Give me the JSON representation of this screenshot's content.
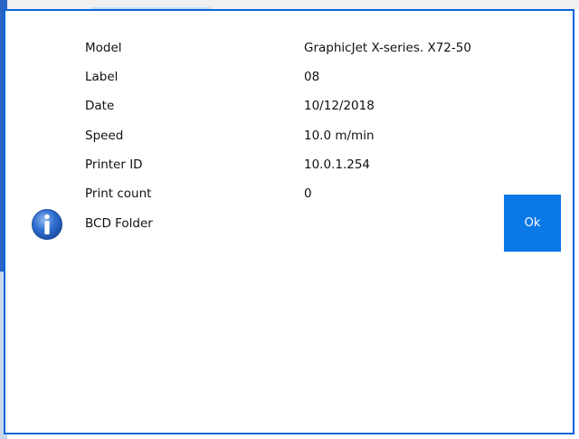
{
  "dialog": {
    "rows": [
      {
        "label": "Model",
        "value": "GraphicJet X-series. X72-50"
      },
      {
        "label": "Label",
        "value": "08"
      },
      {
        "label": "Date",
        "value": "10/12/2018"
      },
      {
        "label": "Speed",
        "value": "10.0 m/min"
      },
      {
        "label": "Printer ID",
        "value": "10.0.1.254"
      },
      {
        "label": "Print count",
        "value": "0"
      },
      {
        "label": "BCD Folder",
        "value": ""
      }
    ],
    "ok_label": "Ok",
    "icon": "info-icon"
  },
  "colors": {
    "accent": "#0a64d8",
    "button": "#0a78e6",
    "icon_blue": "#2f6fd0"
  }
}
